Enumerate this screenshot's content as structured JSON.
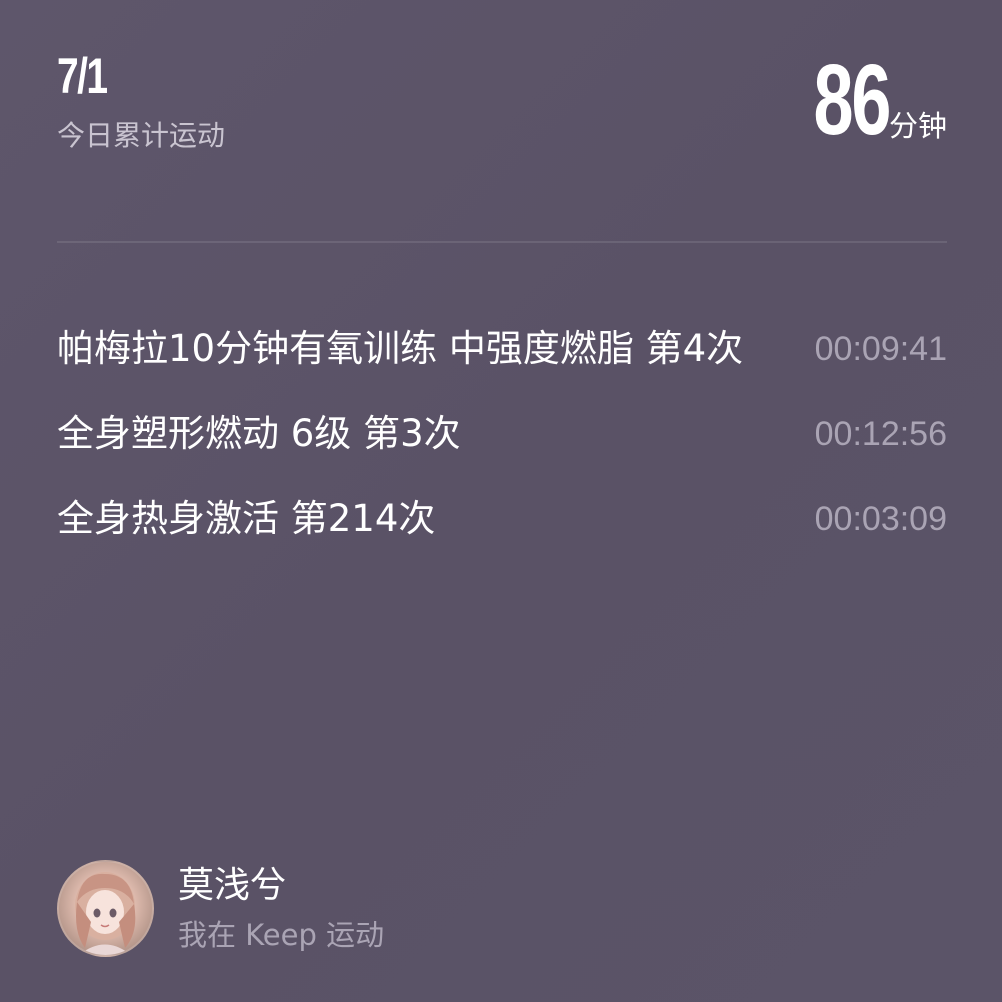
{
  "summary": {
    "date": "7/1",
    "label": "今日累计运动",
    "total_minutes": "86",
    "unit": "分钟"
  },
  "records": [
    {
      "name": "帕梅拉10分钟有氧训练 中强度燃脂 第4次",
      "duration": "00:09:41"
    },
    {
      "name": "全身塑形燃动 6级 第3次",
      "duration": "00:12:56"
    },
    {
      "name": "全身热身激活 第214次",
      "duration": "00:03:09"
    }
  ],
  "profile": {
    "avatar": "avatar-image",
    "name": "莫浅兮",
    "caption": "我在 Keep 运动"
  }
}
